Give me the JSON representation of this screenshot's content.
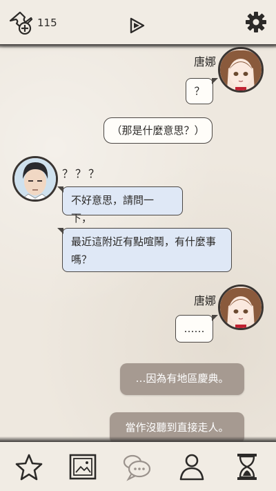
{
  "header": {
    "ticket_count": "115",
    "icons": [
      "ticket-add-icon",
      "play-icon",
      "gear-icon"
    ]
  },
  "chat": {
    "speaker1_name": "唐娜",
    "bubble1": "？",
    "bubble2": "（那是什麼意思？）",
    "speaker2_name": "？？？",
    "bubble3": "不好意思，請問一下，",
    "bubble4_line1": "最近這附近有點喧鬧，有什麼事",
    "bubble4_line2": "嗎？",
    "speaker3_name": "唐娜",
    "bubble5": "……"
  },
  "choices": {
    "choice1": "…因為有地區慶典。",
    "choice2": "當作沒聽到直接走人。"
  },
  "bottom_nav": [
    "star-icon",
    "gallery-icon",
    "chat-icon",
    "profile-icon",
    "hourglass-icon"
  ],
  "colors": {
    "paper": "#eee8df",
    "bubble_white": "#fffdf9",
    "bubble_blue": "#dfe8f6",
    "choice": "#a69a91",
    "ink": "#2b2927"
  }
}
